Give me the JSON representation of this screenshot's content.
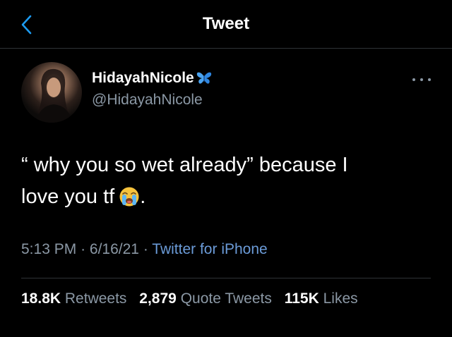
{
  "header": {
    "back_icon": "chevron-left-icon",
    "title": "Tweet"
  },
  "tweet": {
    "author": {
      "display_name": "HidayahNicole",
      "name_emoji": "butterfly-icon",
      "handle": "@HidayahNicole"
    },
    "more_icon": "more-horizontal-icon",
    "text_line_1": "“ why you so wet already” because I",
    "text_line_2": "love you tf",
    "text_emoji": "loudly-crying-face-icon",
    "text_end": ".",
    "time": "5:13 PM",
    "date": "6/16/21",
    "separator": "·",
    "source": "Twitter for iPhone"
  },
  "stats": {
    "retweets_count": "18.8K",
    "retweets_label": "Retweets",
    "quotes_count": "2,879",
    "quotes_label": "Quote Tweets",
    "likes_count": "115K",
    "likes_label": "Likes"
  },
  "colors": {
    "background": "#000000",
    "text_primary": "#ffffff",
    "text_secondary": "#8b98a5",
    "link": "#6b9bd8",
    "divider": "#2f3336"
  }
}
